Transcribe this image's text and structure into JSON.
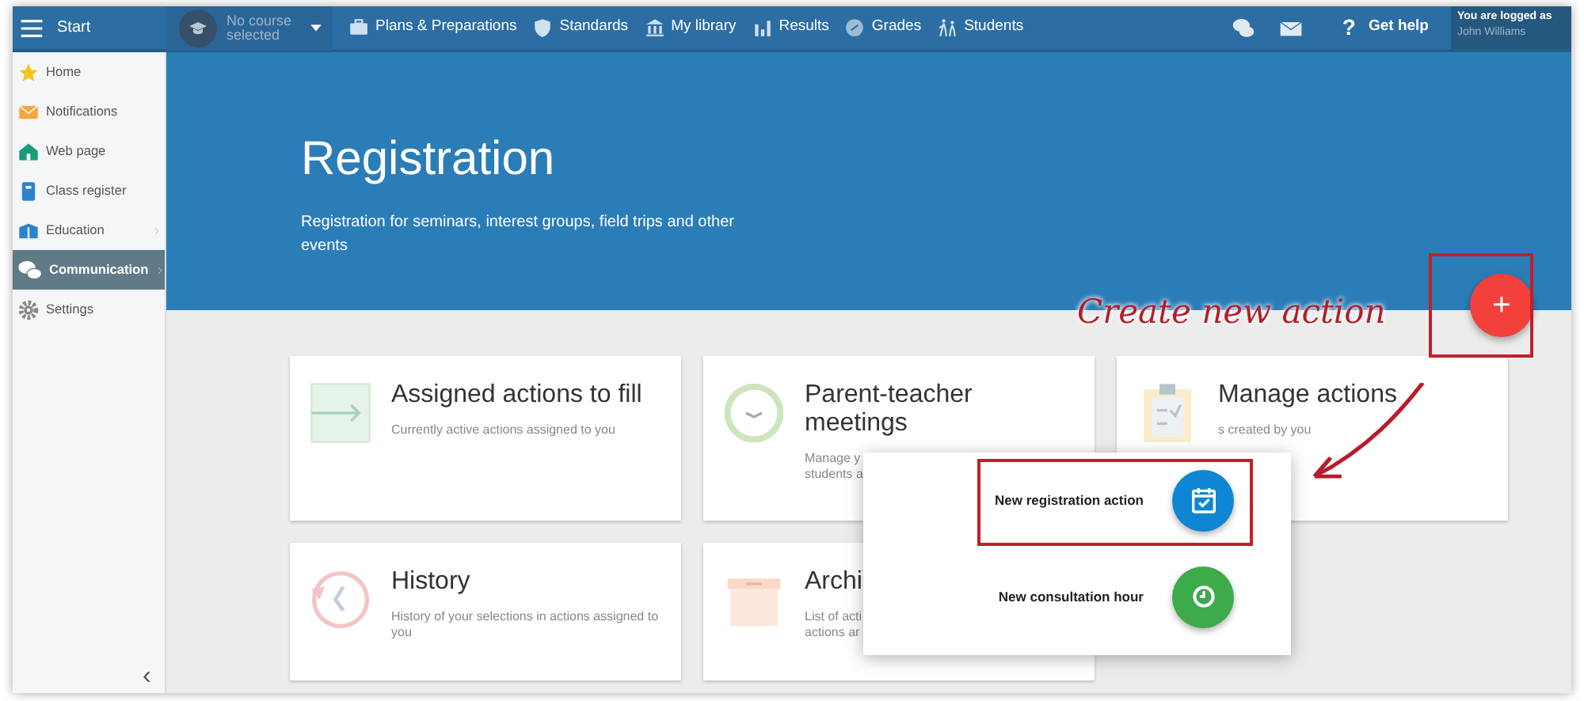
{
  "topbar": {
    "menu_label": "Start",
    "course": {
      "label": "No course selected"
    },
    "nav": [
      {
        "label": "Plans & Preparations",
        "kind": "briefcase"
      },
      {
        "label": "Standards",
        "kind": "shield"
      },
      {
        "label": "My library",
        "kind": "library"
      },
      {
        "label": "Results",
        "kind": "chart"
      },
      {
        "label": "Grades",
        "kind": "grades"
      },
      {
        "label": "Students",
        "kind": "students"
      }
    ],
    "help": {
      "mark": "?",
      "label": "Get help"
    },
    "user": {
      "caption": "You are logged as",
      "name": "John Williams"
    }
  },
  "sidebar": {
    "items": [
      {
        "label": "Home",
        "kind": "star",
        "selected": false,
        "expandable": false
      },
      {
        "label": "Notifications",
        "kind": "mail",
        "selected": false,
        "expandable": false
      },
      {
        "label": "Web page",
        "kind": "house",
        "selected": false,
        "expandable": false
      },
      {
        "label": "Class register",
        "kind": "book",
        "selected": false,
        "expandable": false
      },
      {
        "label": "Education",
        "kind": "education",
        "selected": false,
        "expandable": true
      },
      {
        "label": "Communication",
        "kind": "chat",
        "selected": true,
        "expandable": true
      },
      {
        "label": "Settings",
        "kind": "gear",
        "selected": false,
        "expandable": false
      }
    ],
    "collapse": "‹"
  },
  "hero": {
    "title": "Registration",
    "subtitle": "Registration for seminars, interest groups, field trips and other events"
  },
  "cards": [
    {
      "title": "Assigned actions to fill",
      "lines": [
        "Currently active actions assigned to you"
      ],
      "kind": "arrow"
    },
    {
      "title": "Parent-teacher meetings",
      "lines": [
        "Manage y",
        "students a"
      ],
      "kind": "clock"
    },
    {
      "title": "Manage actions",
      "lines": [
        "s created by you"
      ],
      "kind": "clipboard"
    },
    {
      "title": "History",
      "lines": [
        "History of your selections in actions assigned to you"
      ],
      "kind": "history"
    },
    {
      "title": "Archi",
      "lines": [
        "List of acti",
        "actions ar"
      ],
      "kind": "box"
    }
  ],
  "fab": {
    "label": "+"
  },
  "popup": {
    "items": [
      {
        "label": "New registration action",
        "kind": "calendar",
        "highlighted": true
      },
      {
        "label": "New consultation hour",
        "kind": "clock",
        "highlighted": false
      }
    ]
  },
  "annotation": {
    "text": "Create new action"
  }
}
